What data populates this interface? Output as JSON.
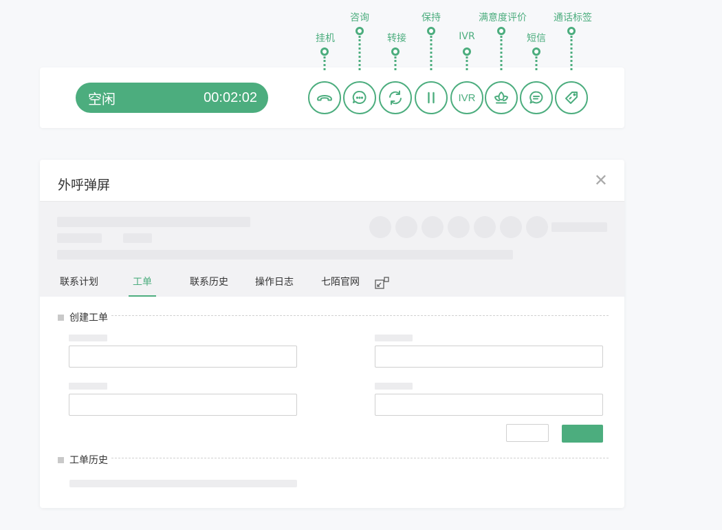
{
  "status": {
    "state": "空闲",
    "timer": "00:02:02"
  },
  "toolbar": {
    "hangup_label": "挂机",
    "consult_label": "咨询",
    "transfer_label": "转接",
    "hold_label": "保持",
    "ivr_label": "IVR",
    "ivr_icon_text": "IVR",
    "satisfaction_label": "满意度评价",
    "sms_label": "短信",
    "tag_label": "通话标签"
  },
  "popup": {
    "title": "外呼弹屏",
    "close": "✕",
    "tabs": [
      "联系计划",
      "工单",
      "联系历史",
      "操作日志",
      "七陌官网"
    ],
    "active_tab": "工单",
    "sections": {
      "create": "创建工单",
      "history": "工单历史"
    },
    "form": {
      "field1_value": "",
      "field2_value": "",
      "field3_value": "",
      "field4_value": ""
    }
  },
  "colors": {
    "accent": "#4cad7e",
    "background": "#f7f8fa",
    "placeholder": "#e8e8eb"
  },
  "icons": [
    "hangup-icon",
    "consult-icon",
    "transfer-icon",
    "pause-icon",
    "ivr-icon",
    "satisfaction-icon",
    "sms-icon",
    "tag-icon",
    "popout-icon",
    "close-icon"
  ]
}
